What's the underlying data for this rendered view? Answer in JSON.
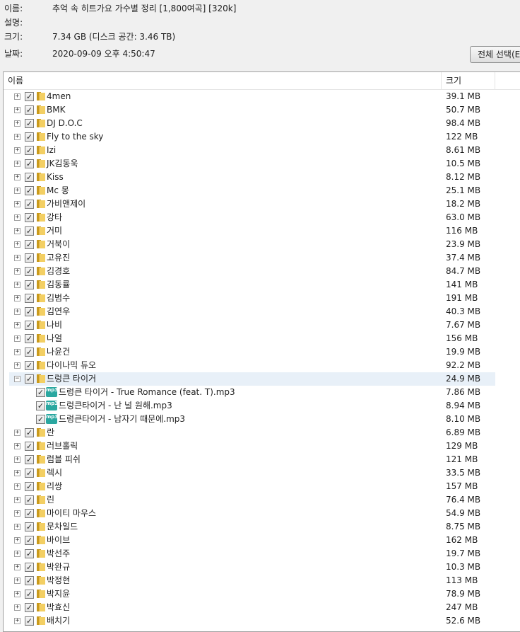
{
  "info": {
    "name_label": "이름:",
    "name_value": "추억 속 히트가요 가수별 정리 [1,800여곡] [320k]",
    "desc_label": "설명:",
    "desc_value": "",
    "size_label": "크기:",
    "size_value": "7.34 GB (디스크 공간: 3.46 TB)",
    "date_label": "날짜:",
    "date_value": "2020-09-09 오후 4:50:47",
    "select_all_label": "전체 선택(E)"
  },
  "list": {
    "header_name": "이름",
    "header_size": "크기",
    "rows": [
      {
        "type": "folder",
        "name": "4men",
        "size": "39.1 MB"
      },
      {
        "type": "folder",
        "name": "BMK",
        "size": "50.7 MB"
      },
      {
        "type": "folder",
        "name": "DJ D.O.C",
        "size": "98.4 MB"
      },
      {
        "type": "folder",
        "name": "Fly to the sky",
        "size": "122 MB"
      },
      {
        "type": "folder",
        "name": "Izi",
        "size": "8.61 MB"
      },
      {
        "type": "folder",
        "name": "JK김동욱",
        "size": "10.5 MB"
      },
      {
        "type": "folder",
        "name": "Kiss",
        "size": "8.12 MB"
      },
      {
        "type": "folder",
        "name": "Mc 몽",
        "size": "25.1 MB"
      },
      {
        "type": "folder",
        "name": "가비앤제이",
        "size": "18.2 MB"
      },
      {
        "type": "folder",
        "name": "강타",
        "size": "63.0 MB"
      },
      {
        "type": "folder",
        "name": "거미",
        "size": "116 MB"
      },
      {
        "type": "folder",
        "name": "거북이",
        "size": "23.9 MB"
      },
      {
        "type": "folder",
        "name": "고유진",
        "size": "37.4 MB"
      },
      {
        "type": "folder",
        "name": "김경호",
        "size": "84.7 MB"
      },
      {
        "type": "folder",
        "name": "김동률",
        "size": "141 MB"
      },
      {
        "type": "folder",
        "name": "김범수",
        "size": "191 MB"
      },
      {
        "type": "folder",
        "name": "김연우",
        "size": "40.3 MB"
      },
      {
        "type": "folder",
        "name": "나비",
        "size": "7.67 MB"
      },
      {
        "type": "folder",
        "name": "나얼",
        "size": "156 MB"
      },
      {
        "type": "folder",
        "name": "나윤건",
        "size": "19.9 MB"
      },
      {
        "type": "folder",
        "name": "다이나믹 듀오",
        "size": "92.2 MB"
      },
      {
        "type": "folder",
        "name": "드렁큰 타이거",
        "size": "24.9 MB",
        "expanded": true,
        "selected": true
      },
      {
        "type": "file",
        "name": "드렁큰 타이거 - True Romance (feat. T).mp3",
        "size": "7.86 MB"
      },
      {
        "type": "file",
        "name": "드렁큰타이거 - 난 널 원해.mp3",
        "size": "8.94 MB"
      },
      {
        "type": "file",
        "name": "드렁큰타이거 - 남자기 때문에.mp3",
        "size": "8.10 MB"
      },
      {
        "type": "folder",
        "name": "란",
        "size": "6.89 MB"
      },
      {
        "type": "folder",
        "name": "러브홀릭",
        "size": "129 MB"
      },
      {
        "type": "folder",
        "name": "럼블 피쉬",
        "size": "121 MB"
      },
      {
        "type": "folder",
        "name": "렉시",
        "size": "33.5 MB"
      },
      {
        "type": "folder",
        "name": "리쌍",
        "size": "157 MB"
      },
      {
        "type": "folder",
        "name": "린",
        "size": "76.4 MB"
      },
      {
        "type": "folder",
        "name": "마이티 마우스",
        "size": "54.9 MB"
      },
      {
        "type": "folder",
        "name": "문차일드",
        "size": "8.75 MB"
      },
      {
        "type": "folder",
        "name": "바이브",
        "size": "162 MB"
      },
      {
        "type": "folder",
        "name": "박선주",
        "size": "19.7 MB"
      },
      {
        "type": "folder",
        "name": "박완규",
        "size": "10.3 MB"
      },
      {
        "type": "folder",
        "name": "박정현",
        "size": "113 MB"
      },
      {
        "type": "folder",
        "name": "박지윤",
        "size": "78.9 MB"
      },
      {
        "type": "folder",
        "name": "박효신",
        "size": "247 MB"
      },
      {
        "type": "folder",
        "name": "배치기",
        "size": "52.6 MB"
      }
    ]
  }
}
